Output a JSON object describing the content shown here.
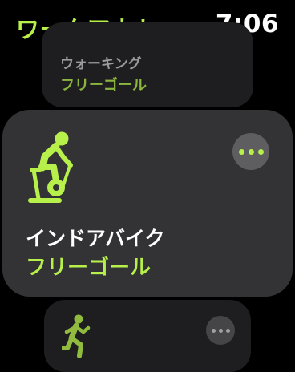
{
  "header": {
    "title": "ワークアウト",
    "time": "7:06"
  },
  "colors": {
    "accent": "#b7f04a",
    "accent_dim": "#8fbf38"
  },
  "workouts": [
    {
      "name": "ウォーキング",
      "goal": "フリーゴール",
      "icon": "walking-icon"
    },
    {
      "name": "インドアバイク",
      "goal": "フリーゴール",
      "icon": "indoor-cycle-icon",
      "more_icon": "more-icon"
    },
    {
      "name": "",
      "goal": "",
      "icon": "running-icon",
      "more_icon": "more-icon"
    }
  ]
}
